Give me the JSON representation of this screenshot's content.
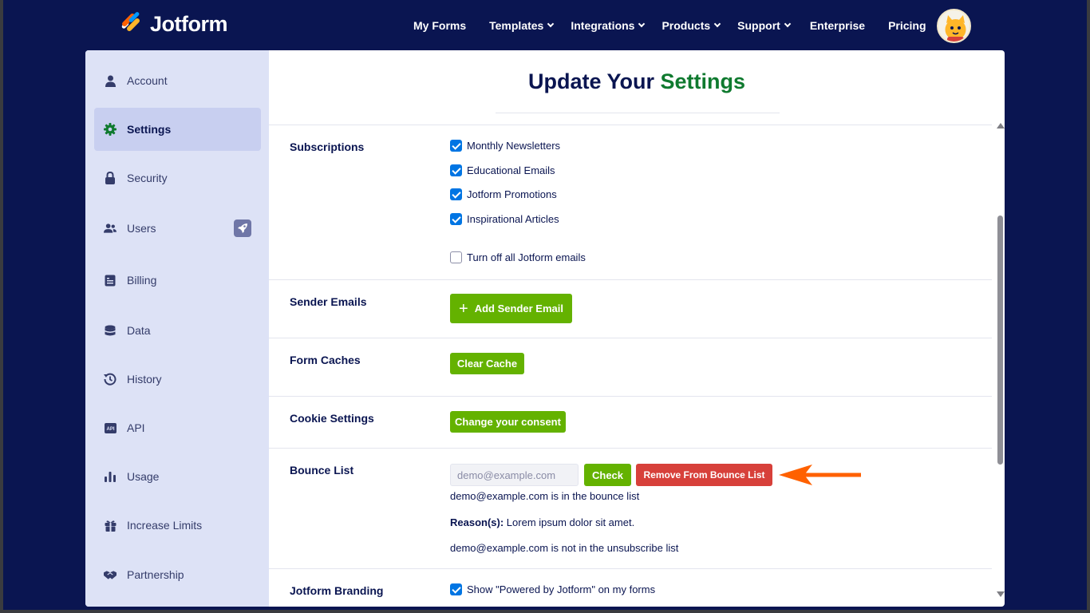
{
  "header": {
    "logo_text": "Jotform",
    "nav": [
      {
        "label": "My Forms",
        "dropdown": false
      },
      {
        "label": "Templates",
        "dropdown": true
      },
      {
        "label": "Integrations",
        "dropdown": true
      },
      {
        "label": "Products",
        "dropdown": true
      },
      {
        "label": "Support",
        "dropdown": true
      },
      {
        "label": "Enterprise",
        "dropdown": false
      },
      {
        "label": "Pricing",
        "dropdown": false
      }
    ],
    "avatar_icon": "user-avatar-icon"
  },
  "sidebar": {
    "items": [
      {
        "label": "Account",
        "icon": "user-icon",
        "active": false
      },
      {
        "label": "Settings",
        "icon": "gear-icon",
        "active": true
      },
      {
        "label": "Security",
        "icon": "lock-icon",
        "active": false
      },
      {
        "label": "Users",
        "icon": "users-icon",
        "active": false,
        "badge_icon": "rocket-icon"
      },
      {
        "label": "Billing",
        "icon": "billing-icon",
        "active": false
      },
      {
        "label": "Data",
        "icon": "database-icon",
        "active": false
      },
      {
        "label": "History",
        "icon": "history-icon",
        "active": false
      },
      {
        "label": "API",
        "icon": "api-icon",
        "active": false
      },
      {
        "label": "Usage",
        "icon": "bar-chart-icon",
        "active": false
      },
      {
        "label": "Increase Limits",
        "icon": "gift-icon",
        "active": false
      },
      {
        "label": "Partnership",
        "icon": "handshake-icon",
        "active": false
      }
    ]
  },
  "main": {
    "title_part1": "Update Your ",
    "title_part2": "Settings",
    "subscriptions": {
      "label": "Subscriptions",
      "options": [
        {
          "label": "Monthly Newsletters",
          "checked": true
        },
        {
          "label": "Educational Emails",
          "checked": true
        },
        {
          "label": "Jotform Promotions",
          "checked": true
        },
        {
          "label": "Inspirational Articles",
          "checked": true
        }
      ],
      "turn_off": {
        "label": "Turn off all Jotform emails",
        "checked": false
      }
    },
    "sender_emails": {
      "label": "Sender Emails",
      "button": "Add Sender Email"
    },
    "form_caches": {
      "label": "Form Caches",
      "button": "Clear Cache"
    },
    "cookie_settings": {
      "label": "Cookie Settings",
      "button": "Change your consent"
    },
    "bounce_list": {
      "label": "Bounce List",
      "input_placeholder": "demo@example.com",
      "check_button": "Check",
      "remove_button": "Remove From Bounce List",
      "result_line": "demo@example.com is in the bounce list",
      "reason_label": "Reason(s):",
      "reason_text": " Lorem ipsum dolor sit amet.",
      "unsubscribe_line": "demo@example.com is not in the unsubscribe list"
    },
    "branding": {
      "label": "Jotform Branding",
      "option": {
        "label": "Show \"Powered by Jotform\" on my forms",
        "checked": true
      }
    }
  },
  "colors": {
    "header_bg": "#0a1551",
    "accent_green": "#64b200",
    "danger_red": "#d7403a",
    "checkbox_blue": "#0075e3",
    "annotation_arrow": "#ff6100"
  }
}
